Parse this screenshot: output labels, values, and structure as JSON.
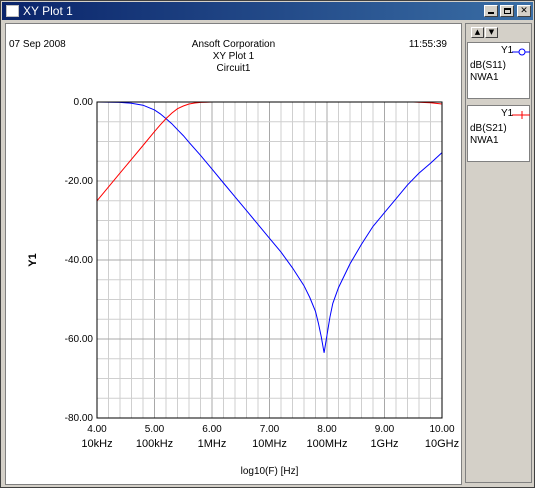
{
  "window": {
    "title": "XY Plot 1"
  },
  "header": {
    "date": "07 Sep 2008",
    "company": "Ansoft Corporation",
    "plot_name": "XY Plot 1",
    "design": "Circuit1",
    "time": "11:55:39"
  },
  "legend": {
    "entries": [
      {
        "axis": "Y1",
        "trace": "dB(S11)",
        "setup": "NWA1",
        "color": "#0000ff",
        "marker": "circle"
      },
      {
        "axis": "Y1",
        "trace": "dB(S21)",
        "setup": "NWA1",
        "color": "#ff0000",
        "marker": "cross"
      }
    ]
  },
  "chart_data": {
    "type": "line",
    "xlabel": "log10(F) [Hz]",
    "ylabel": "Y1",
    "xlim": [
      4.0,
      10.0
    ],
    "ylim": [
      -80.0,
      0.0
    ],
    "xticks": [
      4.0,
      5.0,
      6.0,
      7.0,
      8.0,
      9.0,
      10.0
    ],
    "xtick_labels": [
      "4.00",
      "5.00",
      "6.00",
      "7.00",
      "8.00",
      "9.00",
      "10.00"
    ],
    "xtick_freq_labels": [
      "10kHz",
      "100kHz",
      "1MHz",
      "10MHz",
      "100MHz",
      "1GHz",
      "10GHz"
    ],
    "yticks": [
      0,
      -20,
      -40,
      -60,
      -80
    ],
    "ytick_labels": [
      "0.00",
      "-20.00",
      "-40.00",
      "-60.00",
      "-80.00"
    ],
    "grid": true,
    "series": [
      {
        "name": "dB(S11)",
        "color": "#0000ff",
        "x": [
          4.0,
          4.4,
          4.6,
          4.8,
          5.0,
          5.1,
          5.2,
          5.3,
          5.4,
          5.5,
          5.6,
          5.8,
          6.0,
          6.2,
          6.4,
          6.6,
          6.8,
          7.0,
          7.2,
          7.4,
          7.6,
          7.7,
          7.8,
          7.85,
          7.9,
          7.95,
          8.0,
          8.05,
          8.1,
          8.2,
          8.4,
          8.6,
          8.8,
          9.0,
          9.2,
          9.4,
          9.6,
          9.8,
          10.0
        ],
        "y": [
          0.0,
          -0.1,
          -0.3,
          -0.8,
          -2.0,
          -3.0,
          -4.2,
          -5.5,
          -7.0,
          -8.5,
          -10.2,
          -13.5,
          -17.0,
          -20.5,
          -24.0,
          -27.5,
          -31.0,
          -34.5,
          -38.0,
          -42.0,
          -46.5,
          -49.5,
          -53.0,
          -56.0,
          -59.5,
          -63.5,
          -59.0,
          -54.5,
          -51.0,
          -47.0,
          -41.0,
          -36.0,
          -31.5,
          -28.0,
          -24.5,
          -21.0,
          -18.0,
          -15.5,
          -12.8
        ]
      },
      {
        "name": "dB(S21)",
        "color": "#ff0000",
        "x": [
          4.0,
          4.2,
          4.4,
          4.6,
          4.8,
          5.0,
          5.1,
          5.2,
          5.3,
          5.4,
          5.5,
          5.6,
          5.7,
          5.8,
          5.9,
          6.0,
          7.0,
          8.0,
          9.0,
          9.5,
          9.8,
          10.0
        ],
        "y": [
          -25.0,
          -21.5,
          -18.0,
          -14.5,
          -11.0,
          -7.5,
          -5.8,
          -4.2,
          -2.8,
          -1.7,
          -1.0,
          -0.5,
          -0.25,
          -0.1,
          -0.05,
          0.0,
          0.0,
          0.0,
          0.0,
          0.0,
          -0.2,
          -0.5
        ]
      }
    ]
  }
}
